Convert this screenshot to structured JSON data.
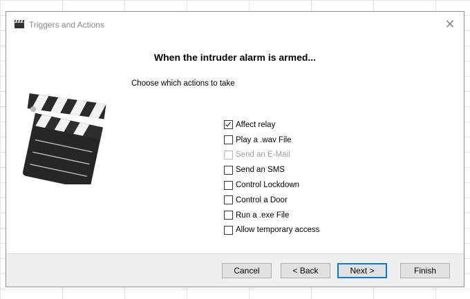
{
  "window": {
    "title": "Triggers and Actions",
    "app_icon": "clapperboard-icon",
    "close_icon": "close-icon",
    "close_glyph": "✕"
  },
  "main": {
    "heading": "When the intruder alarm is armed...",
    "subheading": "Choose which actions to take",
    "illustration": "clapperboard-illustration",
    "actions": [
      {
        "label": "Affect relay",
        "checked": true,
        "enabled": true
      },
      {
        "label": "Play a .wav File",
        "checked": false,
        "enabled": true
      },
      {
        "label": "Send an E-Mail",
        "checked": false,
        "enabled": false
      },
      {
        "label": "Send an SMS",
        "checked": false,
        "enabled": true
      },
      {
        "label": "Control Lockdown",
        "checked": false,
        "enabled": true
      },
      {
        "label": "Control a Door",
        "checked": false,
        "enabled": true
      },
      {
        "label": "Run a .exe File",
        "checked": false,
        "enabled": true
      },
      {
        "label": "Allow temporary access",
        "checked": false,
        "enabled": true
      }
    ]
  },
  "footer": {
    "cancel_label": "Cancel",
    "back_label": "< Back",
    "next_label": "Next >",
    "finish_label": "Finish"
  },
  "colors": {
    "focus_border": "#0078d7",
    "footer_bg": "#f0f0f0",
    "disabled_text": "#a0a0a0"
  }
}
